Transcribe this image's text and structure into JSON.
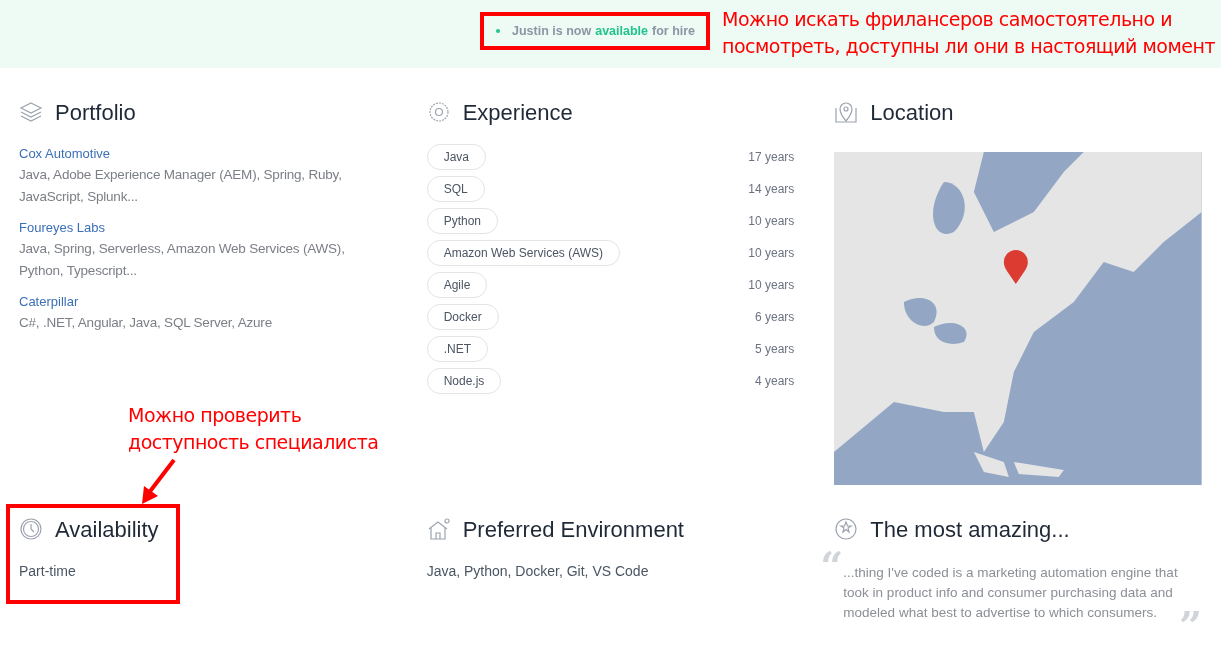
{
  "banner": {
    "status": {
      "before": "Justin is now",
      "highlight": "available",
      "after": "for hire"
    }
  },
  "portfolio": {
    "title": "Portfolio",
    "items": [
      {
        "company": "Cox Automotive",
        "skills": "Java, Adobe Experience Manager (AEM), Spring, Ruby, JavaScript, Splunk..."
      },
      {
        "company": "Foureyes Labs",
        "skills": "Java, Spring, Serverless, Amazon Web Services (AWS), Python, Typescript..."
      },
      {
        "company": "Caterpillar",
        "skills": "C#, .NET, Angular, Java, SQL Server, Azure"
      }
    ]
  },
  "experience": {
    "title": "Experience",
    "items": [
      {
        "skill": "Java",
        "years": "17 years"
      },
      {
        "skill": "SQL",
        "years": "14 years"
      },
      {
        "skill": "Python",
        "years": "10 years"
      },
      {
        "skill": "Amazon Web Services (AWS)",
        "years": "10 years"
      },
      {
        "skill": "Agile",
        "years": "10 years"
      },
      {
        "skill": "Docker",
        "years": "6 years"
      },
      {
        "skill": ".NET",
        "years": "5 years"
      },
      {
        "skill": "Node.js",
        "years": "4 years"
      }
    ]
  },
  "location": {
    "title": "Location"
  },
  "availability": {
    "title": "Availability",
    "value": "Part-time"
  },
  "environment": {
    "title": "Preferred Environment",
    "value": "Java, Python, Docker, Git, VS Code"
  },
  "amazing": {
    "title": "The most amazing...",
    "open_quote": "“",
    "text": "...thing I've coded is a marketing automation engine that took in product info and consumer purchasing data and modeled what best to advertise to which consumers.",
    "close_quote": "”"
  },
  "annotations": [
    {
      "text": "Можно искать фрилансеров самостоятельно и посмотреть, доступны ли они в настоящий момент"
    },
    {
      "text": "Можно проверить доступность специалиста"
    }
  ]
}
